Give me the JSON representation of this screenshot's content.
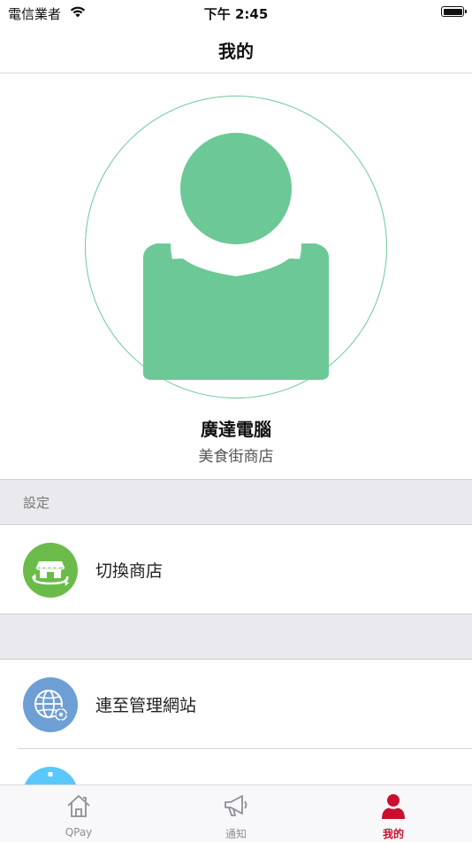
{
  "status_bar": {
    "carrier": "電信業者",
    "time": "下午 2:45"
  },
  "nav": {
    "title": "我的"
  },
  "profile": {
    "name": "廣達電腦",
    "shop": "美食街商店",
    "avatar_color": "#6cc896"
  },
  "sections": [
    {
      "header": "設定",
      "items": [
        {
          "label": "切換商店",
          "icon": "store-switch-icon",
          "color": "#6bbb4a"
        }
      ]
    },
    {
      "header": "",
      "items": [
        {
          "label": "連至管理網站",
          "icon": "globe-gear-icon",
          "color": "#6e9fd4"
        },
        {
          "label": "",
          "icon": "info-icon",
          "color": "#5ac8fa"
        }
      ]
    }
  ],
  "tabs": [
    {
      "label": "QPay",
      "icon": "home-icon",
      "active": false
    },
    {
      "label": "通知",
      "icon": "megaphone-icon",
      "active": false
    },
    {
      "label": "我的",
      "icon": "person-icon",
      "active": true
    }
  ],
  "colors": {
    "accent": "#c8102e",
    "inactive": "#8e8e93"
  }
}
